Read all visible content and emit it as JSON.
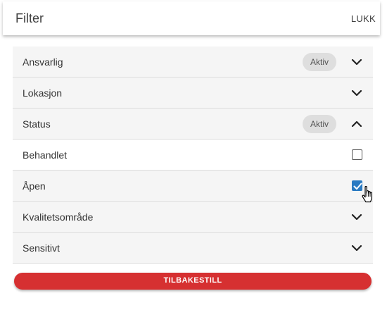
{
  "header": {
    "title": "Filter",
    "close_label": "LUKK"
  },
  "filters": [
    {
      "label": "Ansvarlig",
      "badge": "Aktiv",
      "expanded": false
    },
    {
      "label": "Lokasjon",
      "badge": "",
      "expanded": false
    },
    {
      "label": "Status",
      "badge": "Aktiv",
      "expanded": true,
      "options": [
        {
          "label": "Behandlet",
          "checked": false
        },
        {
          "label": "Åpen",
          "checked": true
        }
      ]
    },
    {
      "label": "Kvalitetsområde",
      "badge": "",
      "expanded": false
    },
    {
      "label": "Sensitivt",
      "badge": "",
      "expanded": false
    }
  ],
  "reset_label": "TILBAKESTILL",
  "colors": {
    "accent": "#d63031",
    "checkbox": "#2a7ac2",
    "badge_bg": "#dedede",
    "row_bg": "#f5f5f5"
  },
  "icons": {
    "collapsed": "chevron-down-icon",
    "expanded": "chevron-up-icon",
    "cursor": "hand-pointer-icon"
  }
}
